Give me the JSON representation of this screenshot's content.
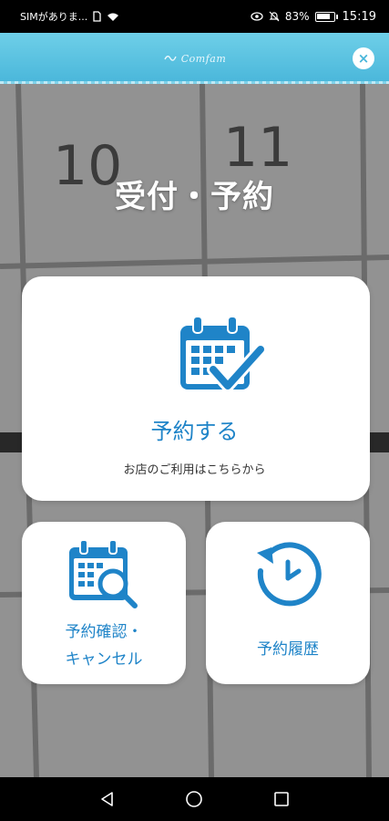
{
  "status_bar": {
    "carrier": "SIMがありま...",
    "battery_percent": "83%",
    "battery_level": 0.83,
    "time": "15:19"
  },
  "header": {
    "logo_text": "Comfam",
    "close_symbol": "×"
  },
  "page": {
    "title": "受付・予約"
  },
  "background_calendar": {
    "day_numbers": [
      "10",
      "11"
    ]
  },
  "cards": {
    "reserve": {
      "label": "予約する",
      "subtitle": "お店のご利用はこちらから",
      "icon": "calendar-check-icon"
    },
    "confirm": {
      "label_line1": "予約確認・",
      "label_line2": "キャンセル",
      "icon": "calendar-search-icon"
    },
    "history": {
      "label": "予約履歴",
      "icon": "clock-history-icon"
    }
  },
  "colors": {
    "accent": "#1f84c8",
    "header": "#49b6da",
    "card_bg": "#ffffff"
  },
  "nav_bar": {
    "buttons": [
      "back",
      "home",
      "recents"
    ]
  }
}
